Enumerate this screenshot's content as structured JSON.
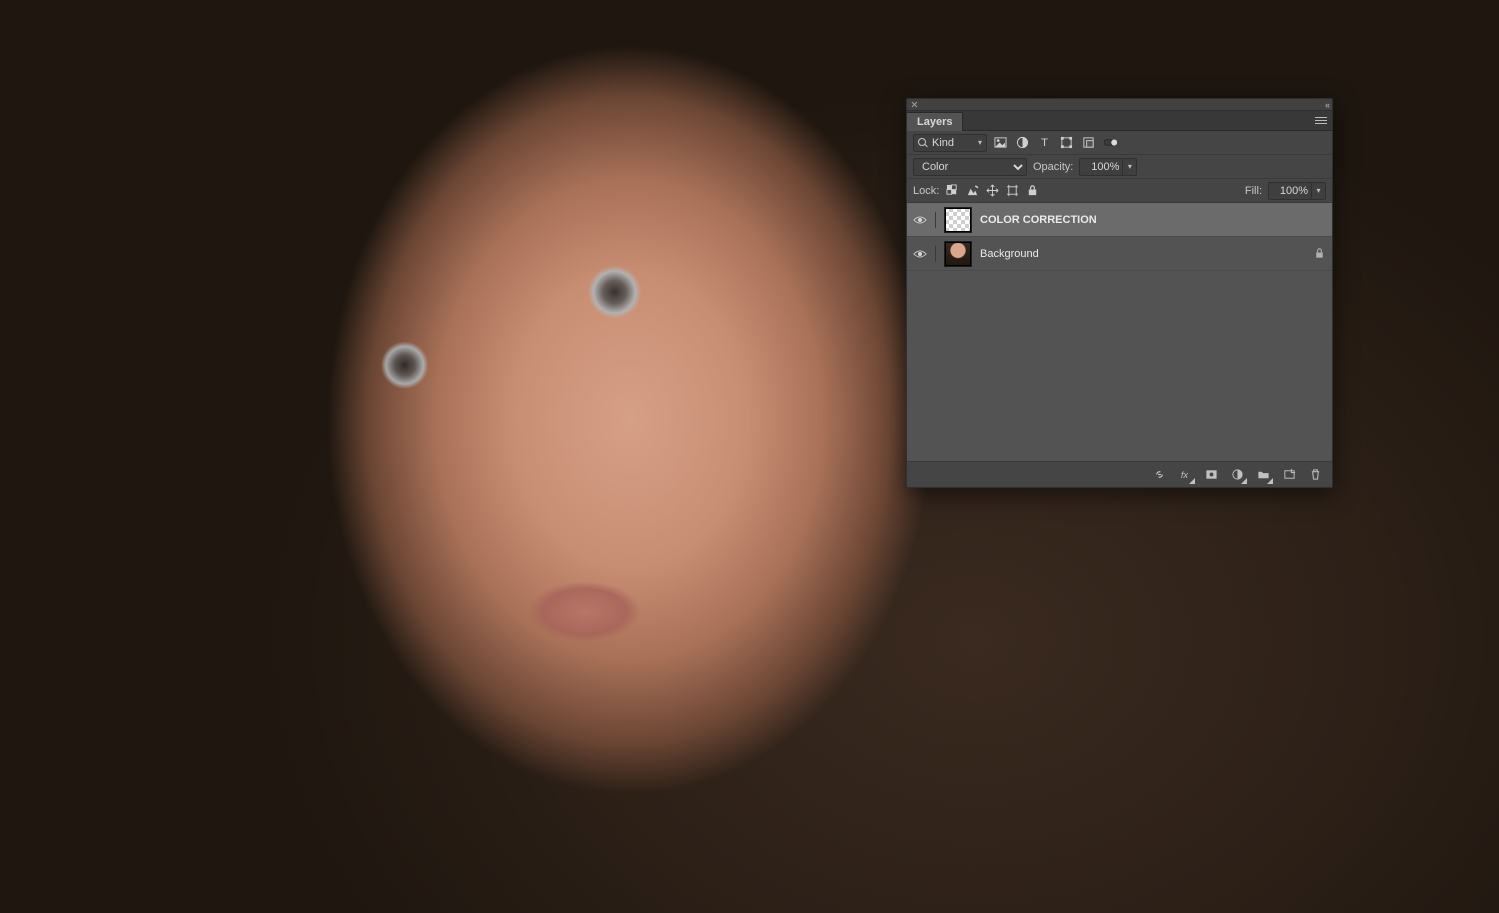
{
  "panel": {
    "title": "Layers",
    "filter": {
      "kind_label": "Kind",
      "icons": [
        "image-filter",
        "adjustment-filter",
        "type-filter",
        "shape-filter",
        "smartobject-filter",
        "artboard-filter"
      ]
    },
    "blend_mode": "Color",
    "opacity": {
      "label": "Opacity:",
      "value": "100%"
    },
    "lock": {
      "label": "Lock:",
      "icons": [
        "lock-transparent",
        "lock-image",
        "lock-position",
        "lock-artboard",
        "lock-all"
      ]
    },
    "fill": {
      "label": "Fill:",
      "value": "100%"
    },
    "layers": [
      {
        "name": "COLOR CORRECTION",
        "visible": true,
        "selected": true,
        "thumb": "transparent",
        "locked": false
      },
      {
        "name": "Background",
        "visible": true,
        "selected": false,
        "thumb": "portrait",
        "locked": true
      }
    ],
    "footer_icons": [
      "link-layers",
      "fx",
      "mask",
      "adjustment",
      "group",
      "new-layer",
      "delete"
    ]
  }
}
